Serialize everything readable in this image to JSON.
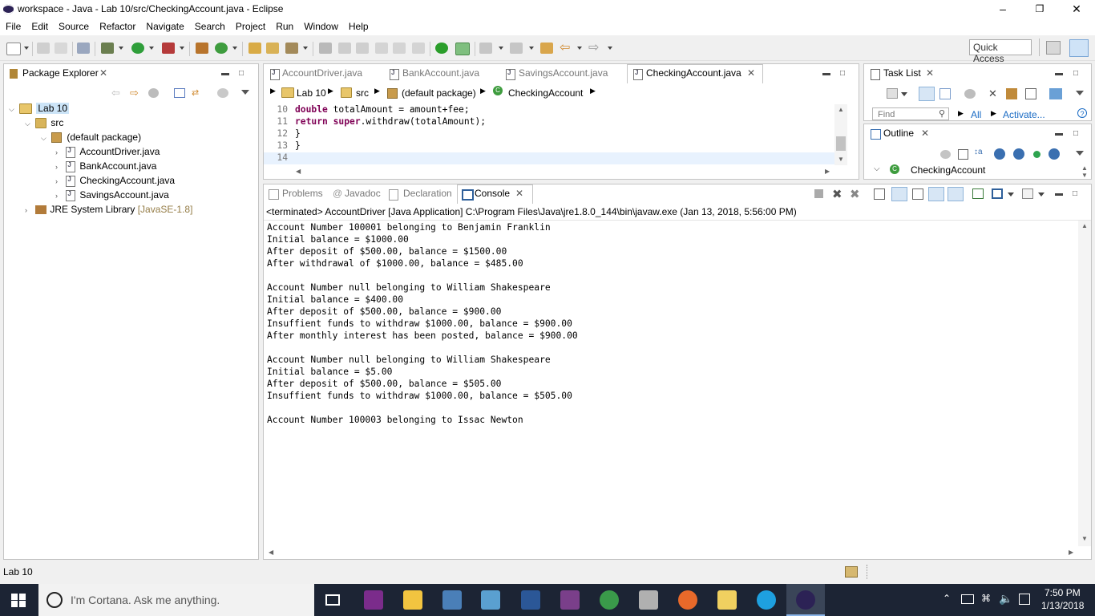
{
  "window": {
    "title": "workspace - Java - Lab 10/src/CheckingAccount.java - Eclipse"
  },
  "menu": [
    "File",
    "Edit",
    "Source",
    "Refactor",
    "Navigate",
    "Search",
    "Project",
    "Run",
    "Window",
    "Help"
  ],
  "toolbar": {
    "quick_access": "Quick Access"
  },
  "package_explorer": {
    "tab_label": "Package Explorer",
    "project": "Lab 10",
    "src": "src",
    "package": "(default package)",
    "files": [
      "AccountDriver.java",
      "BankAccount.java",
      "CheckingAccount.java",
      "SavingsAccount.java"
    ],
    "jre": "JRE System Library",
    "jre_suffix": "[JavaSE-1.8]"
  },
  "editor": {
    "tabs": [
      "AccountDriver.java",
      "BankAccount.java",
      "SavingsAccount.java",
      "CheckingAccount.java"
    ],
    "breadcrumb": {
      "project": "Lab 10",
      "src": "src",
      "package": "(default package)",
      "class": "CheckingAccount"
    },
    "lines": [
      {
        "num": "10",
        "kw": "double",
        "rest": " totalAmount = amount+fee;"
      },
      {
        "num": "11",
        "kw": "return super",
        "rest": ".withdraw(totalAmount);"
      },
      {
        "num": "12",
        "kw": "",
        "rest": "}"
      },
      {
        "num": "13",
        "kw": "",
        "rest": "}"
      },
      {
        "num": "14",
        "kw": "",
        "rest": ""
      }
    ]
  },
  "task_list": {
    "tab_label": "Task List",
    "find_placeholder": "Find",
    "all": "All",
    "activate": "Activate..."
  },
  "outline": {
    "tab_label": "Outline",
    "class": "CheckingAccount"
  },
  "bottom_tabs": {
    "problems": "Problems",
    "javadoc": "Javadoc",
    "declaration": "Declaration",
    "console": "Console"
  },
  "console": {
    "header": "<terminated> AccountDriver [Java Application] C:\\Program Files\\Java\\jre1.8.0_144\\bin\\javaw.exe (Jan 13, 2018, 5:56:00 PM)",
    "output": "Account Number 100001 belonging to Benjamin Franklin\nInitial balance = $1000.00\nAfter deposit of $500.00, balance = $1500.00\nAfter withdrawal of $1000.00, balance = $485.00\n\nAccount Number null belonging to William Shakespeare\nInitial balance = $400.00\nAfter deposit of $500.00, balance = $900.00\nInsuffient funds to withdraw $1000.00, balance = $900.00\nAfter monthly interest has been posted, balance = $900.00\n\nAccount Number null belonging to William Shakespeare\nInitial balance = $5.00\nAfter deposit of $500.00, balance = $505.00\nInsuffient funds to withdraw $1000.00, balance = $505.00\n\nAccount Number 100003 belonging to Issac Newton"
  },
  "status": {
    "left": "Lab 10"
  },
  "taskbar": {
    "cortana": "I'm Cortana. Ask me anything.",
    "time": "7:50 PM",
    "date": "1/13/2018"
  }
}
